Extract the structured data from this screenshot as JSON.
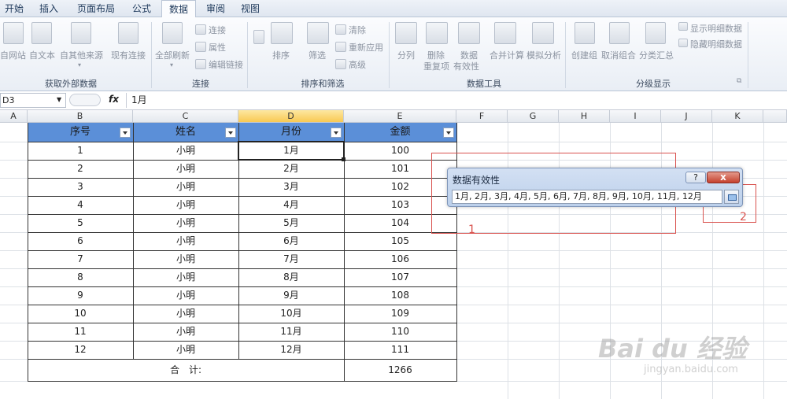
{
  "tabs": [
    "开始",
    "插入",
    "页面布局",
    "公式",
    "数据",
    "审阅",
    "视图"
  ],
  "ribbon": {
    "external": {
      "items": [
        "自网站",
        "自文本",
        "自其他来源",
        "现有连接"
      ],
      "group": "获取外部数据"
    },
    "connections": {
      "refresh": "全部刷新",
      "items": [
        "连接",
        "属性",
        "编辑链接"
      ],
      "group": "连接"
    },
    "sort": {
      "sort": "排序",
      "filter": "筛选",
      "items": [
        "清除",
        "重新应用",
        "高级"
      ],
      "group": "排序和筛选"
    },
    "tools": {
      "split": "分列",
      "dedupe_1": "删除",
      "dedupe_2": "重复项",
      "valid_1": "数据",
      "valid_2": "有效性",
      "merge": "合并计算",
      "whatif": "模拟分析",
      "group": "数据工具"
    },
    "outline": {
      "create": "创建组",
      "ungroup": "取消组合",
      "subtotal": "分类汇总",
      "show": "显示明细数据",
      "hide": "隐藏明细数据",
      "group": "分级显示"
    }
  },
  "formula_bar": {
    "name_box": "D3",
    "fx": "fx",
    "value": "1月"
  },
  "columns": [
    "A",
    "B",
    "C",
    "D",
    "E",
    "F",
    "G",
    "H",
    "I",
    "J",
    "K"
  ],
  "table": {
    "headers": [
      "序号",
      "姓名",
      "月份",
      "金额"
    ],
    "rows": [
      [
        "1",
        "小明",
        "1月",
        "100"
      ],
      [
        "2",
        "小明",
        "2月",
        "101"
      ],
      [
        "3",
        "小明",
        "3月",
        "102"
      ],
      [
        "4",
        "小明",
        "4月",
        "103"
      ],
      [
        "5",
        "小明",
        "5月",
        "104"
      ],
      [
        "6",
        "小明",
        "6月",
        "105"
      ],
      [
        "7",
        "小明",
        "7月",
        "106"
      ],
      [
        "8",
        "小明",
        "8月",
        "107"
      ],
      [
        "9",
        "小明",
        "9月",
        "108"
      ],
      [
        "10",
        "小明",
        "10月",
        "109"
      ],
      [
        "11",
        "小明",
        "11月",
        "110"
      ],
      [
        "12",
        "小明",
        "12月",
        "111"
      ]
    ],
    "total_label": "合　计:",
    "total_value": "1266"
  },
  "dialog": {
    "title": "数据有效性",
    "help": "?",
    "close": "x",
    "source": "1月, 2月, 3月, 4月, 5月, 6月, 7月, 8月, 9月, 10月, 11月, 12月"
  },
  "annotations": [
    "1",
    "2"
  ],
  "watermark": {
    "brand": "Bai du 经验",
    "url": "jingyan.baidu.com"
  },
  "colors": {
    "header_fill": "#5b8fd8",
    "selected_col": "#f8c953",
    "annotation": "#d9534f"
  }
}
